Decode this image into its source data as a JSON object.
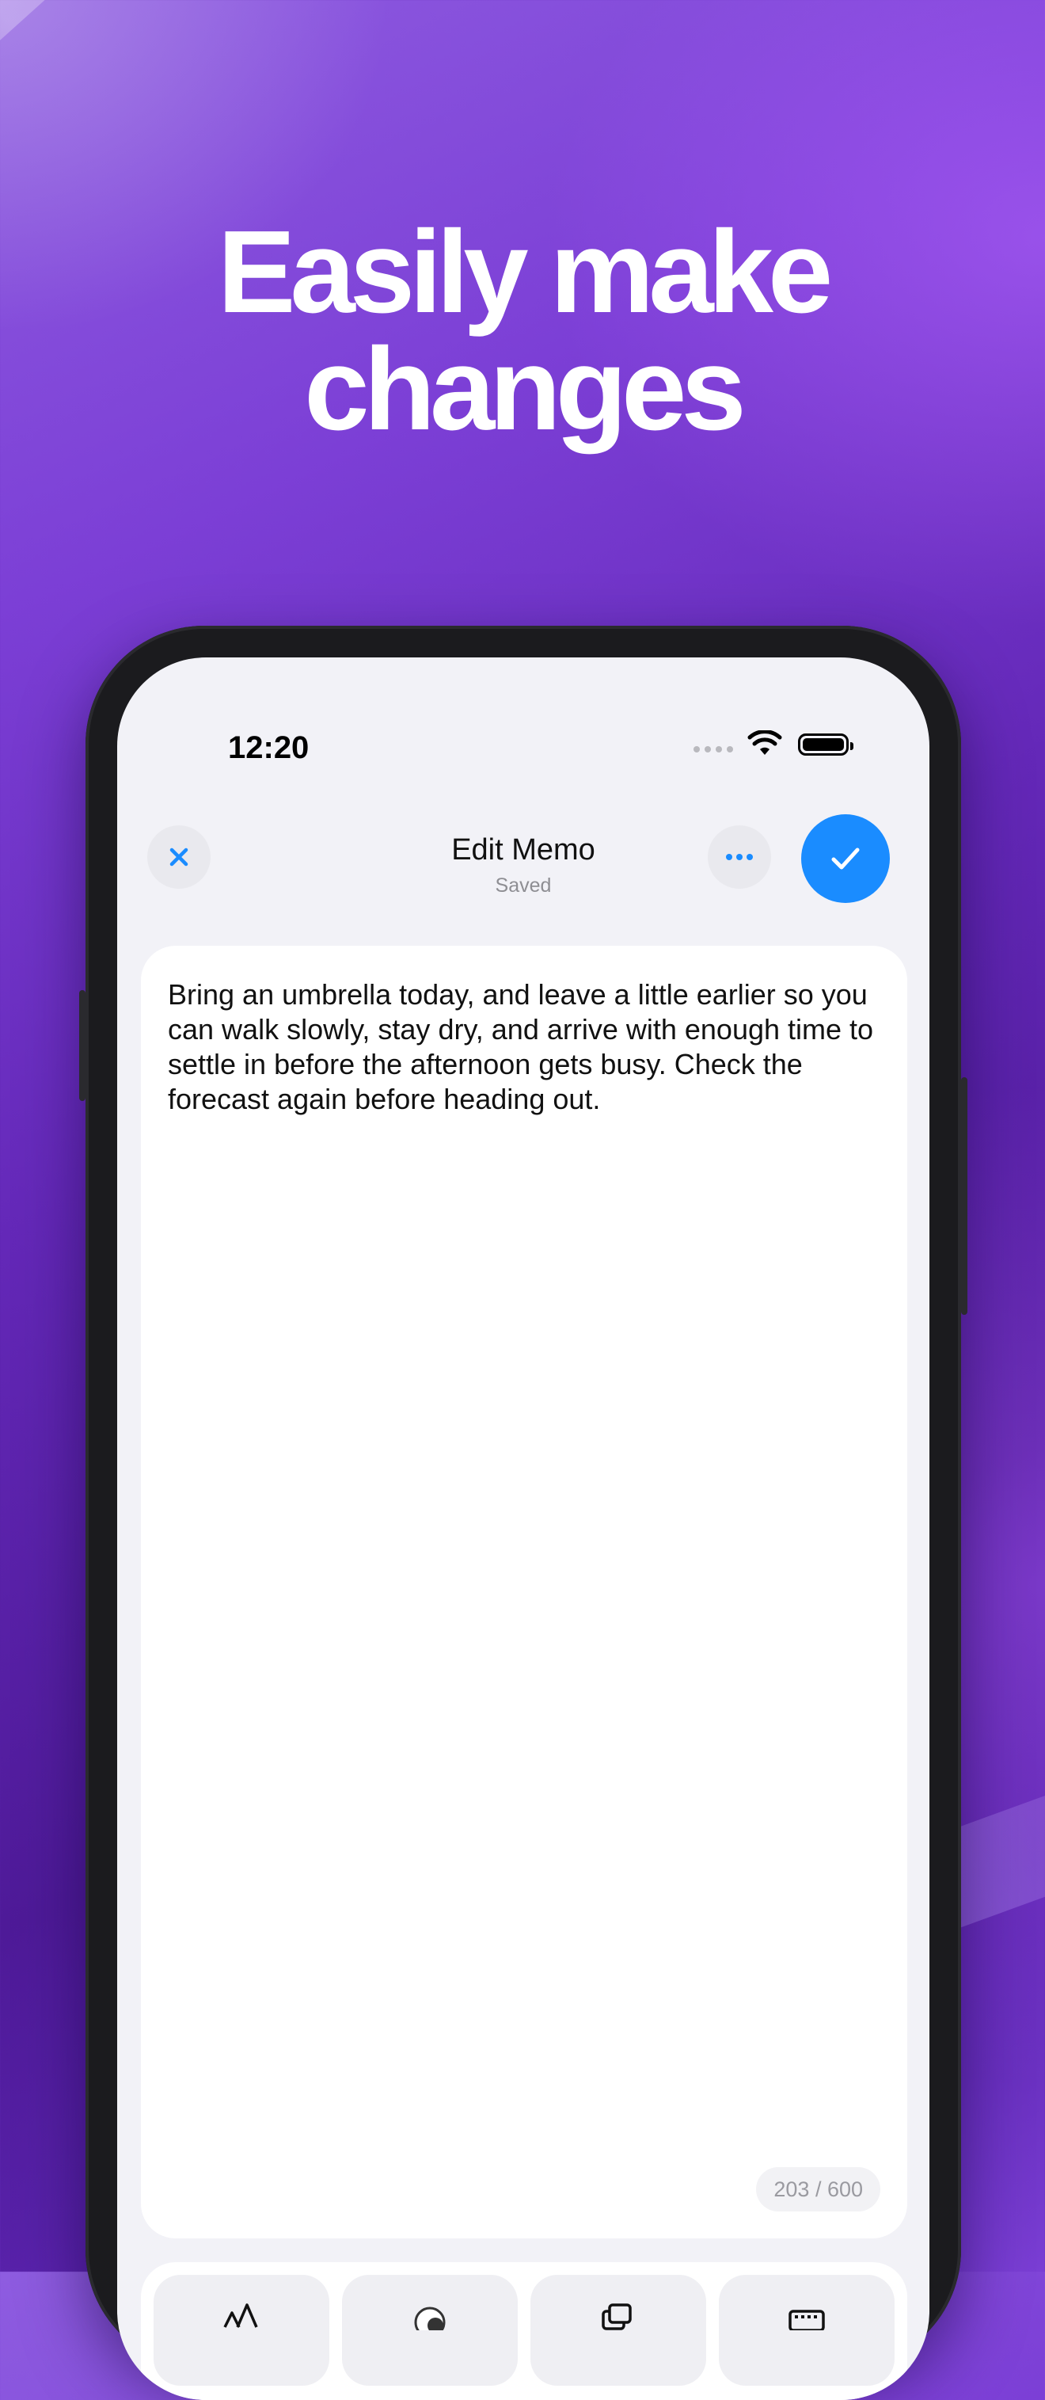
{
  "headline": {
    "line1": "Easily make",
    "line2": "changes"
  },
  "status_bar": {
    "time": "12:20",
    "signal_icon": "signal-dots-icon",
    "wifi_icon": "wifi-icon",
    "battery_icon": "battery-icon"
  },
  "nav": {
    "title": "Edit Memo",
    "subtitle": "Saved",
    "close_icon": "close-icon",
    "more_icon": "ellipsis-icon",
    "confirm_icon": "checkmark-icon"
  },
  "editor": {
    "text": "Bring an umbrella today, and leave a little earlier so you can walk slowly, stay dry, and arrive with enough time to settle in before the afternoon gets busy. Check the forecast again before heading out.",
    "counter": "203 / 600"
  },
  "toolbar": {
    "items": [
      {
        "icon": "text-size-icon"
      },
      {
        "icon": "toggle-icon"
      },
      {
        "icon": "copy-icon"
      },
      {
        "icon": "keyboard-icon"
      }
    ]
  },
  "colors": {
    "accent": "#1a8cff",
    "background_purple": "#6428b8",
    "screen_bg": "#f2f2f7"
  }
}
